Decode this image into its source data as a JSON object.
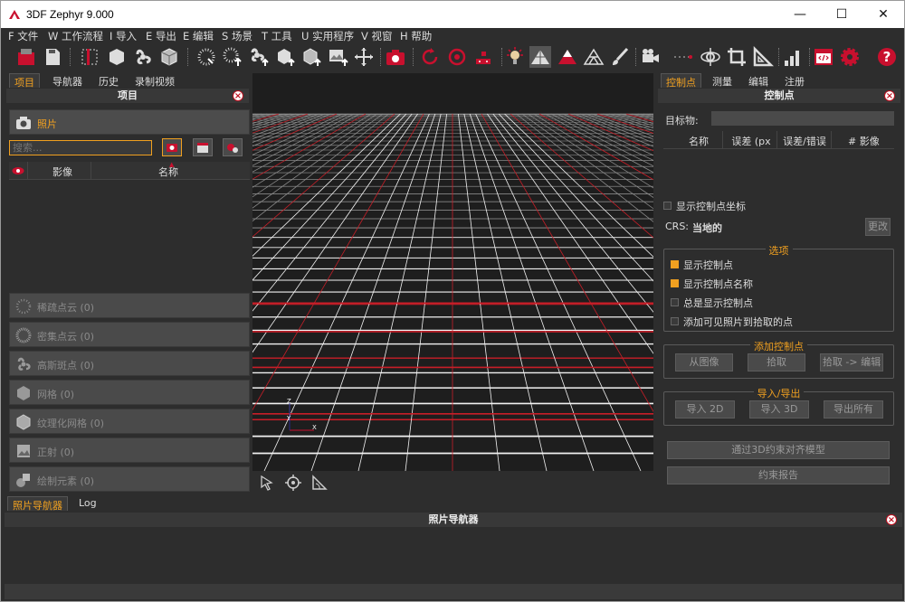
{
  "window": {
    "title": "3DF Zephyr 9.000",
    "minimize": "—",
    "maximize": "☐",
    "close": "✕"
  },
  "menu": [
    "F 文件",
    "W 工作流程",
    "I 导入",
    "E 导出",
    "E 编辑",
    "S 场景",
    "T 工具",
    "U 实用程序",
    "V 视窗",
    "H 帮助"
  ],
  "toolbar": [
    "new-project",
    "save-project",
    "workflow",
    "mesh",
    "split",
    "textured-mesh",
    "dense-points",
    "import-points",
    "tie-points",
    "mesh-import",
    "mesh-import-2",
    "image-import",
    "move-points",
    "screenshot",
    "rotate-left",
    "rotate-right",
    "control-points",
    "light-bulb",
    "triangle-solid",
    "triangle-red",
    "triangle-outline",
    "brush",
    "camera-track",
    "dotted-line",
    "orbit",
    "crop",
    "ruler-triangle",
    "level-bars",
    "code-window",
    "settings",
    "help"
  ],
  "left": {
    "tabs": [
      "项目",
      "导航器",
      "历史",
      "录制视频"
    ],
    "header": "项目",
    "photos_label": "照片",
    "search_placeholder": "搜索...",
    "columns": {
      "eye": "",
      "image": "影像",
      "name": "名称"
    },
    "stacks": [
      "稀疏点云 (0)",
      "密集点云 (0)",
      "高斯斑点 (0)",
      "网格 (0)",
      "纹理化网格 (0)",
      "正射 (0)",
      "绘制元素 (0)"
    ]
  },
  "viewport": {
    "axis_z": "Z",
    "axis_y": "Y",
    "axis_x": "X",
    "tools": [
      "pointer",
      "target",
      "protractor"
    ]
  },
  "right": {
    "tabs": [
      "控制点",
      "测量",
      "编辑",
      "注册"
    ],
    "header": "控制点",
    "target_label": "目标物:",
    "columns": [
      "名称",
      "误差 (px",
      "误差/错误",
      "# 影像"
    ],
    "show_coords": "显示控制点坐标",
    "crs_label": "CRS:",
    "crs_value": "当地的",
    "change_button": "更改",
    "options": {
      "title": "选项",
      "items": [
        {
          "label": "显示控制点",
          "checked": true
        },
        {
          "label": "显示控制点名称",
          "checked": true
        },
        {
          "label": "总是显示控制点",
          "checked": false
        },
        {
          "label": "添加可见照片到拾取的点",
          "checked": false
        }
      ]
    },
    "add": {
      "title": "添加控制点",
      "buttons": [
        "从图像",
        "拾取",
        "拾取 -> 编辑"
      ]
    },
    "io": {
      "title": "导入/导出",
      "buttons": [
        "导入 2D",
        "导入 3D",
        "导出所有"
      ]
    },
    "align_button": "通过3D约束对齐模型",
    "report_button": "约束报告"
  },
  "bottom": {
    "tabs": [
      "照片导航器",
      "Log"
    ],
    "header": "照片导航器"
  },
  "colors": {
    "accent": "#f0a020",
    "grid_red": "#c81e28",
    "grid_white": "#f2f2f2",
    "close_red": "#c01020"
  }
}
